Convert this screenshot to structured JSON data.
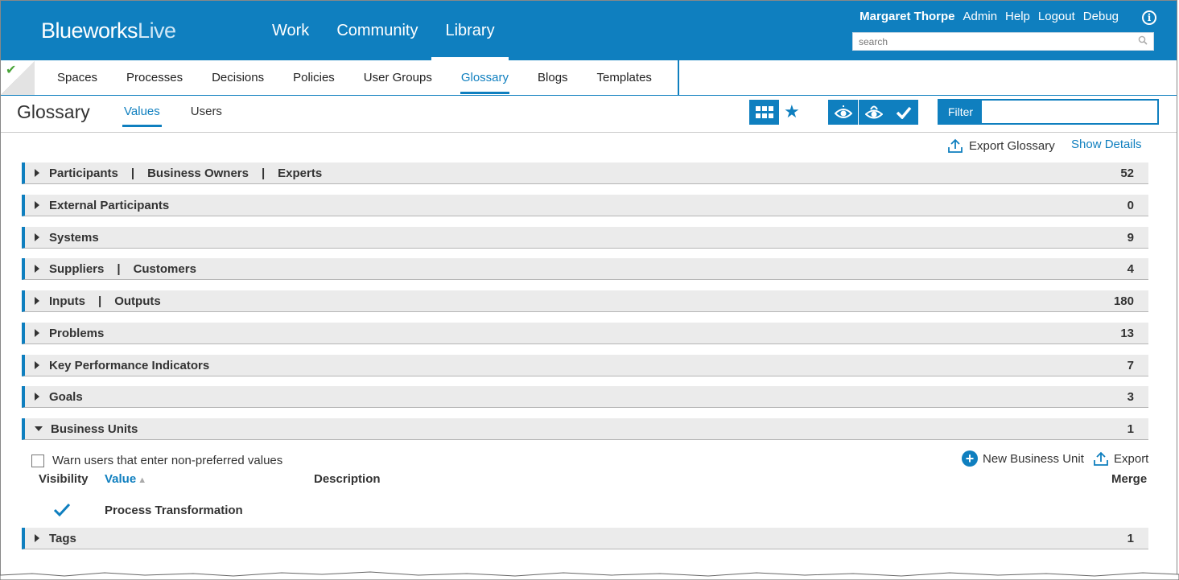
{
  "header": {
    "logo_bold": "Blueworks",
    "logo_light": "Live",
    "nav": [
      "Work",
      "Community",
      "Library"
    ],
    "active_nav": "Library",
    "user": "Margaret Thorpe",
    "links": [
      "Admin",
      "Help",
      "Logout",
      "Debug"
    ],
    "search_placeholder": "search"
  },
  "subnav": {
    "items": [
      "Spaces",
      "Processes",
      "Decisions",
      "Policies",
      "User Groups",
      "Glossary",
      "Blogs",
      "Templates"
    ],
    "active": "Glossary"
  },
  "page": {
    "title": "Glossary",
    "tabs": [
      "Values",
      "Users"
    ],
    "active_tab": "Values",
    "filter_label": "Filter",
    "export_glossary": "Export Glossary",
    "show_details": "Show Details"
  },
  "categories": [
    {
      "labels": [
        "Participants",
        "Business Owners",
        "Experts"
      ],
      "count": "52",
      "expanded": false
    },
    {
      "labels": [
        "External Participants"
      ],
      "count": "0",
      "expanded": false
    },
    {
      "labels": [
        "Systems"
      ],
      "count": "9",
      "expanded": false
    },
    {
      "labels": [
        "Suppliers",
        "Customers"
      ],
      "count": "4",
      "expanded": false
    },
    {
      "labels": [
        "Inputs",
        "Outputs"
      ],
      "count": "180",
      "expanded": false
    },
    {
      "labels": [
        "Problems"
      ],
      "count": "13",
      "expanded": false
    },
    {
      "labels": [
        "Key Performance Indicators"
      ],
      "count": "7",
      "expanded": false
    },
    {
      "labels": [
        "Goals"
      ],
      "count": "3",
      "expanded": false
    },
    {
      "labels": [
        "Business Units"
      ],
      "count": "1",
      "expanded": true
    },
    {
      "labels": [
        "Tags"
      ],
      "count": "1",
      "expanded": false
    }
  ],
  "business_units": {
    "warn_label": "Warn users that enter non-preferred values",
    "warn_checked": false,
    "new_label": "New Business Unit",
    "export_label": "Export",
    "columns": {
      "visibility": "Visibility",
      "value": "Value",
      "description": "Description",
      "merge": "Merge"
    },
    "rows": [
      {
        "visible": true,
        "value": "Process Transformation",
        "description": ""
      }
    ]
  },
  "colors": {
    "accent": "#0f7fbf",
    "row_bg": "#ebebeb"
  }
}
